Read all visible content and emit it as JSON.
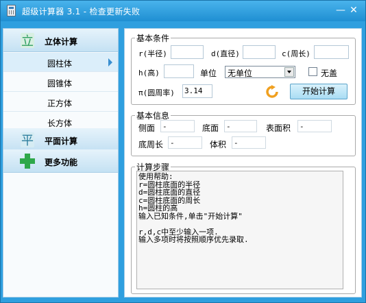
{
  "window": {
    "title": "超级计算器 3.1 - 检查更新失败",
    "minimize_glyph": "—",
    "close_glyph": "✕"
  },
  "sidebar": {
    "categories": [
      {
        "label": "立体计算",
        "icon": "cube-icon",
        "icon_glyph": "立",
        "icon_color": "#2f9f5f"
      },
      {
        "label": "平面计算",
        "icon": "plane-icon",
        "icon_glyph": "平",
        "icon_color": "#2f7f9f"
      },
      {
        "label": "更多功能",
        "icon": "plus-icon",
        "icon_color": "#2fa84a"
      }
    ],
    "items": [
      {
        "label": "圆柱体",
        "selected": true
      },
      {
        "label": "圆锥体",
        "selected": false
      },
      {
        "label": "正方体",
        "selected": false
      },
      {
        "label": "长方体",
        "selected": false
      }
    ]
  },
  "conditions": {
    "legend": "基本条件",
    "radius_label": "r(半径)",
    "diameter_label": "d(直径)",
    "circumference_label": "c(周长)",
    "height_label": "h(高)",
    "unit_label": "单位",
    "unit_selected": "无单位",
    "no_unit_checkbox_label": "无盖",
    "pi_label": "π(圆周率)",
    "pi_value": "3.14",
    "start_button": "开始计算"
  },
  "info": {
    "legend": "基本信息",
    "side_area_label": "侧面",
    "side_area_value": "-",
    "base_area_label": "底面",
    "base_area_value": "-",
    "surface_area_label": "表面积",
    "surface_area_value": "-",
    "base_perimeter_label": "底周长",
    "base_perimeter_value": "-",
    "volume_label": "体积",
    "volume_value": "-"
  },
  "steps": {
    "legend": "计算步骤",
    "lines": [
      "使用帮助:",
      "r=圆柱底面的半径",
      "d=圆柱底面的直径",
      "c=圆柱底面的周长",
      "h=圆柱的高",
      "输入已知条件,单击\"开始计算\"",
      "",
      "r,d,c中至少输入一项.",
      "输入多项时将按照顺序优先录取."
    ]
  }
}
